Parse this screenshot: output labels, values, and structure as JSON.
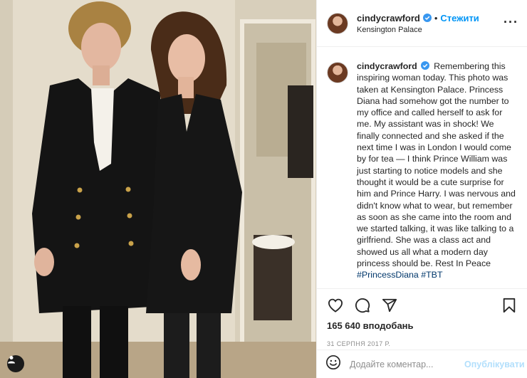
{
  "post": {
    "username": "cindycrawford",
    "verified": true,
    "follow_label": "Стежити",
    "location": "Kensington Palace",
    "more_icon": "ellipsis-icon",
    "caption": "Remembering this inspiring woman today. This photo was taken at Kensington Palace. Princess Diana had somehow got the number to my office and called herself to ask for me. My assistant was in shock! We finally connected and she asked if the next time I was in London I would come by for tea — I think Prince William was just starting to notice models and she thought it would be a cute surprise for him and Prince Harry. I was nervous and didn't know what to wear, but remember as soon as she came into the room and we started talking, it was like talking to a girlfriend. She was a class act and showed us all what a modern day princess should be. Rest In Peace",
    "hashtags": "#PrincessDiana #TBT",
    "likes": "165 640 вподобань",
    "date": "31 СЕРПНЯ 2017 Р."
  },
  "comment": {
    "placeholder": "Додайте коментар...",
    "post_label": "Опублікувати"
  },
  "colors": {
    "accent": "#0095f6",
    "post_disabled": "#b2dffc",
    "verified": "#3897f0"
  }
}
